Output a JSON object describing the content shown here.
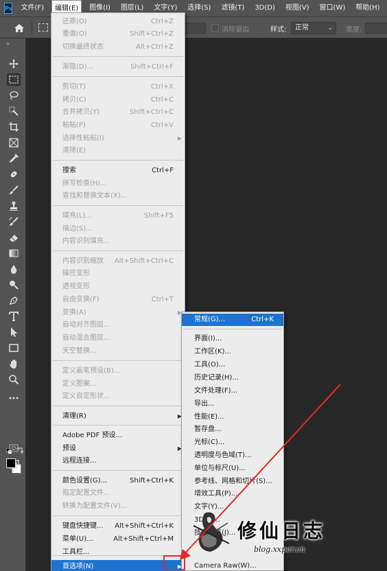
{
  "app_logo": "Ps",
  "menubar": {
    "items": [
      "文件(F)",
      "编辑(E)",
      "图像(I)",
      "图层(L)",
      "文字(Y)",
      "选择(S)",
      "滤镜(T)",
      "3D(D)",
      "视图(V)",
      "窗口(W)",
      "帮助(H)"
    ],
    "active_index": 1
  },
  "options_bar": {
    "antialias_label": "消除锯齿",
    "style_label": "样式:",
    "style_value": "正常",
    "width_label": "宽度:"
  },
  "edit_menu": {
    "items": [
      {
        "label": "还原(O)",
        "shortcut": "Ctrl+Z",
        "disabled": true
      },
      {
        "label": "重做(O)",
        "shortcut": "Shift+Ctrl+Z",
        "disabled": true
      },
      {
        "label": "切换最终状态",
        "shortcut": "Alt+Ctrl+Z",
        "disabled": true
      },
      {
        "label": "渐隐(D)...",
        "shortcut": "Shift+Ctrl+F",
        "disabled": true
      },
      {
        "label": "剪切(T)",
        "shortcut": "Ctrl+X",
        "disabled": true
      },
      {
        "label": "拷贝(C)",
        "shortcut": "Ctrl+C",
        "disabled": true
      },
      {
        "label": "合并拷贝(Y)",
        "shortcut": "Shift+Ctrl+C",
        "disabled": true
      },
      {
        "label": "粘贴(P)",
        "shortcut": "Ctrl+V",
        "disabled": true
      },
      {
        "label": "选择性粘贴(I)",
        "shortcut": "",
        "disabled": true,
        "submenu": true
      },
      {
        "label": "清除(E)",
        "shortcut": "",
        "disabled": true
      },
      {
        "label": "搜索",
        "shortcut": "Ctrl+F",
        "disabled": false
      },
      {
        "label": "拼写检查(H)...",
        "shortcut": "",
        "disabled": true
      },
      {
        "label": "查找和替换文本(X)...",
        "shortcut": "",
        "disabled": true
      },
      {
        "label": "填充(L)...",
        "shortcut": "Shift+F5",
        "disabled": true
      },
      {
        "label": "描边(S)...",
        "shortcut": "",
        "disabled": true
      },
      {
        "label": "内容识别填充...",
        "shortcut": "",
        "disabled": true
      },
      {
        "label": "内容识别缩放",
        "shortcut": "Alt+Shift+Ctrl+C",
        "disabled": true
      },
      {
        "label": "操控变形",
        "shortcut": "",
        "disabled": true
      },
      {
        "label": "透视变形",
        "shortcut": "",
        "disabled": true
      },
      {
        "label": "自由变换(F)",
        "shortcut": "Ctrl+T",
        "disabled": true
      },
      {
        "label": "变换(A)",
        "shortcut": "",
        "disabled": true,
        "submenu": true
      },
      {
        "label": "自动对齐图层...",
        "shortcut": "",
        "disabled": true
      },
      {
        "label": "自动混合图层...",
        "shortcut": "",
        "disabled": true
      },
      {
        "label": "天空替换...",
        "shortcut": "",
        "disabled": true
      },
      {
        "label": "定义画笔预设(B)...",
        "shortcut": "",
        "disabled": true
      },
      {
        "label": "定义图案...",
        "shortcut": "",
        "disabled": true
      },
      {
        "label": "定义自定形状...",
        "shortcut": "",
        "disabled": true
      },
      {
        "label": "清理(R)",
        "shortcut": "",
        "disabled": false,
        "submenu": true
      },
      {
        "label": "Adobe PDF 预设...",
        "shortcut": "",
        "disabled": false
      },
      {
        "label": "预设",
        "shortcut": "",
        "disabled": false,
        "submenu": true
      },
      {
        "label": "远程连接...",
        "shortcut": "",
        "disabled": false
      },
      {
        "label": "颜色设置(G)...",
        "shortcut": "Shift+Ctrl+K",
        "disabled": false
      },
      {
        "label": "指定配置文件...",
        "shortcut": "",
        "disabled": true
      },
      {
        "label": "转换为配置文件(V)...",
        "shortcut": "",
        "disabled": true
      },
      {
        "label": "键盘快捷键...",
        "shortcut": "Alt+Shift+Ctrl+K",
        "disabled": false
      },
      {
        "label": "菜单(U)...",
        "shortcut": "Alt+Shift+Ctrl+M",
        "disabled": false
      },
      {
        "label": "工具栏...",
        "shortcut": "",
        "disabled": false
      },
      {
        "label": "首选项(N)",
        "shortcut": "",
        "disabled": false,
        "submenu": true,
        "highlighted": true
      }
    ]
  },
  "preferences_menu": {
    "items": [
      {
        "label": "常规(G)...",
        "shortcut": "Ctrl+K",
        "highlighted": true
      },
      {
        "label": "界面(I)...",
        "shortcut": ""
      },
      {
        "label": "工作区(K)...",
        "shortcut": ""
      },
      {
        "label": "工具(O)...",
        "shortcut": ""
      },
      {
        "label": "历史记录(H)...",
        "shortcut": ""
      },
      {
        "label": "文件处理(F)...",
        "shortcut": ""
      },
      {
        "label": "导出...",
        "shortcut": ""
      },
      {
        "label": "性能(E)...",
        "shortcut": ""
      },
      {
        "label": "暂存盘...",
        "shortcut": ""
      },
      {
        "label": "光标(C)...",
        "shortcut": ""
      },
      {
        "label": "透明度与色域(T)...",
        "shortcut": ""
      },
      {
        "label": "单位与标尺(U)...",
        "shortcut": ""
      },
      {
        "label": "参考线、网格和切片(S)...",
        "shortcut": ""
      },
      {
        "label": "增效工具(P)...",
        "shortcut": ""
      },
      {
        "label": "文字(Y)...",
        "shortcut": ""
      },
      {
        "label": "3D(3)...",
        "shortcut": ""
      },
      {
        "label": "技术预览(J)...",
        "shortcut": ""
      },
      {
        "label": "",
        "shortcut": ""
      },
      {
        "label": "Camera Raw(W)...",
        "shortcut": ""
      }
    ]
  },
  "watermark": {
    "title": "修仙日志",
    "url": "blog.xxper.cn"
  },
  "colors": {
    "highlight": "#1e73d0",
    "annotation": "#e52828",
    "panel": "#535353",
    "canvas": "#282828"
  }
}
